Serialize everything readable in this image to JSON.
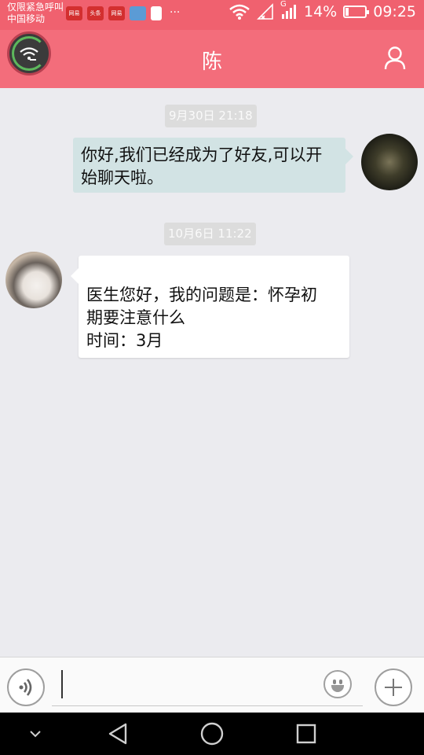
{
  "status_bar": {
    "carrier_line1": "仅限紧急呼叫",
    "carrier_line2": "中国移动",
    "notifications": [
      {
        "label": "网易",
        "icon": "netease-news-icon"
      },
      {
        "label": "头条",
        "icon": "toutiao-icon"
      },
      {
        "label": "网易",
        "icon": "netease-news-icon"
      },
      {
        "label": "",
        "icon": "store-icon"
      },
      {
        "label": "",
        "icon": "sim-toolkit-icon"
      }
    ],
    "more": "···",
    "network_type": "G",
    "battery": "14%",
    "time": "09:25"
  },
  "header": {
    "title": "陈",
    "left_icon": "network-status-icon",
    "right_icon": "user-profile-icon"
  },
  "messages": [
    {
      "timestamp": "9月30日 21:18",
      "side": "right",
      "text_lines": [
        "你好,我们已经成为了好友,可以开",
        "始聊天啦。"
      ]
    },
    {
      "timestamp": "10月6日 11:22",
      "side": "left",
      "text_lines": [
        "医生您好，我的问题是：怀孕初",
        "期要注意什么",
        "时间：3月"
      ]
    }
  ],
  "input_bar": {
    "voice_icon": "voice-input-icon",
    "emoji_icon": "emoji-icon",
    "plus_icon": "plus-icon",
    "text_value": ""
  },
  "nav_bar": {
    "items": [
      "chevron-down-icon",
      "back-triangle-icon",
      "home-circle-icon",
      "recents-square-icon"
    ]
  },
  "colors": {
    "accent": "#f36d7b",
    "status_bar": "#f0616f",
    "chat_bg": "#ebebef",
    "bubble_self": "#d2e3e4",
    "bubble_other": "#ffffff"
  }
}
